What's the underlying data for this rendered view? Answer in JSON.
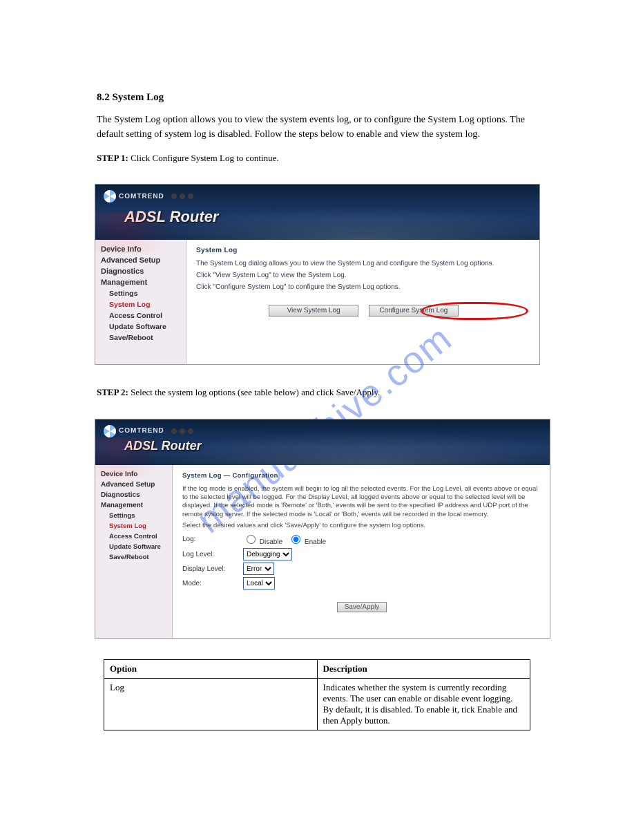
{
  "doc": {
    "section_heading": "8.2 System Log",
    "intro_p1": "The System Log option allows you to view the system events log, or to configure the System Log options. The default setting of system log is disabled. Follow the steps below to enable and view the system log.",
    "step1_heading": "STEP 1:",
    "step1_text": "Click Configure System Log to continue.",
    "step2_heading": "STEP 2:",
    "step2_text": "Select the system log options (see table below) and click Save/Apply."
  },
  "panel1": {
    "brand": "COMTREND",
    "title": "ADSL Router",
    "nav": [
      {
        "label": "Device Info",
        "sub": false,
        "active": false
      },
      {
        "label": "Advanced Setup",
        "sub": false,
        "active": false
      },
      {
        "label": "Diagnostics",
        "sub": false,
        "active": false
      },
      {
        "label": "Management",
        "sub": false,
        "active": false
      },
      {
        "label": "Settings",
        "sub": true,
        "active": false
      },
      {
        "label": "System Log",
        "sub": true,
        "active": true
      },
      {
        "label": "Access Control",
        "sub": true,
        "active": false
      },
      {
        "label": "Update Software",
        "sub": true,
        "active": false
      },
      {
        "label": "Save/Reboot",
        "sub": true,
        "active": false
      }
    ],
    "content_title": "System Log",
    "p1": "The System Log dialog allows you to view the System Log and configure the System Log options.",
    "p2": "Click \"View System Log\" to view the System Log.",
    "p3": "Click \"Configure System Log\" to configure the System Log options.",
    "btn_view": "View System Log",
    "btn_config": "Configure System Log"
  },
  "panel2": {
    "brand": "COMTREND",
    "title": "ADSL Router",
    "nav": [
      {
        "label": "Device Info",
        "sub": false,
        "active": false
      },
      {
        "label": "Advanced Setup",
        "sub": false,
        "active": false
      },
      {
        "label": "Diagnostics",
        "sub": false,
        "active": false
      },
      {
        "label": "Management",
        "sub": false,
        "active": false
      },
      {
        "label": "Settings",
        "sub": true,
        "active": false
      },
      {
        "label": "System Log",
        "sub": true,
        "active": true
      },
      {
        "label": "Access Control",
        "sub": true,
        "active": false
      },
      {
        "label": "Update Software",
        "sub": true,
        "active": false
      },
      {
        "label": "Save/Reboot",
        "sub": true,
        "active": false
      }
    ],
    "content_title": "System Log — Configuration",
    "para1": "If the log mode is enabled, the system will begin to log all the selected events. For the Log Level, all events above or equal to the selected level will be logged. For the Display Level, all logged events above or equal to the selected level will be displayed. If the selected mode is 'Remote' or 'Both,' events will be sent to the specified IP address and UDP port of the remote syslog server. If the selected mode is 'Local' or 'Both,' events will be recorded in the local memory.",
    "para2": "Select the desired values and click 'Save/Apply' to configure the system log options.",
    "log_label": "Log:",
    "log_disable": "Disable",
    "log_enable": "Enable",
    "loglevel_label": "Log Level:",
    "loglevel_value": "Debugging",
    "display_label": "Display Level:",
    "display_value": "Error",
    "mode_label": "Mode:",
    "mode_value": "Local",
    "save_btn": "Save/Apply"
  },
  "table": {
    "h1": "Option",
    "h2": "Description",
    "r1c1": "Log",
    "r1c2": "Indicates whether the system is currently recording events. The user can enable or disable event logging. By default, it is disabled. To enable it, tick Enable and then Apply button."
  },
  "watermark": "manualshive.com"
}
